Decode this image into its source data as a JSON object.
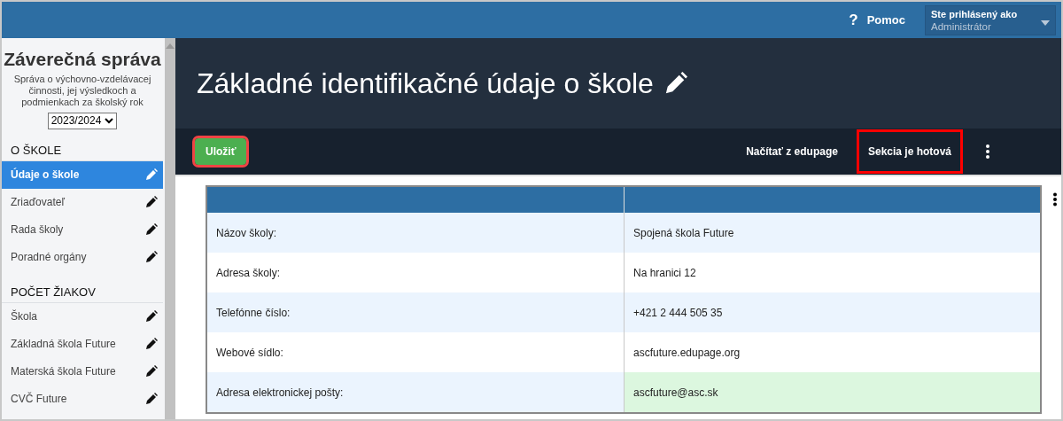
{
  "topbar": {
    "help_icon": "?",
    "help": "Pomoc",
    "user_caption": "Ste prihlásený ako",
    "user_name": "Administrátor"
  },
  "sidebar": {
    "title": "Záverečná správa",
    "subtitle": "Správa o výchovno-vzdelávacej činnosti, jej výsledkoch a podmienkach za školský rok",
    "year": "2023/2024",
    "sections": [
      {
        "heading": "O ŠKOLE",
        "items": [
          {
            "label": "Údaje o škole",
            "selected": true
          },
          {
            "label": "Zriaďovateľ",
            "selected": false
          },
          {
            "label": "Rada školy",
            "selected": false
          },
          {
            "label": "Poradné orgány",
            "selected": false
          }
        ]
      },
      {
        "heading": "POČET ŽIAKOV",
        "items": [
          {
            "label": "Škola",
            "selected": false
          },
          {
            "label": "Základná škola Future",
            "selected": false
          },
          {
            "label": "Materská škola Future",
            "selected": false
          },
          {
            "label": "CVČ Future",
            "selected": false
          }
        ]
      }
    ]
  },
  "page_title": "Základné identifikačné údaje o škole",
  "toolbar": {
    "buttons": [
      {
        "label": "Uložiť",
        "kind": "primary",
        "highlighted": true
      },
      {
        "label": "Načítať z edupage",
        "kind": "plain",
        "highlighted": false
      },
      {
        "label": "Sekcia je hotová",
        "kind": "plain",
        "highlighted": true
      }
    ]
  },
  "table": {
    "rows": [
      {
        "label": "Názov školy:",
        "value": "Spojená škola Future",
        "highlighted": false
      },
      {
        "label": "Adresa školy:",
        "value": "Na hranici 12",
        "highlighted": false
      },
      {
        "label": "Telefónne číslo:",
        "value": "+421 2 444 505 35",
        "highlighted": false
      },
      {
        "label": "Webové sídlo:",
        "value": "ascfuture.edupage.org",
        "highlighted": false
      },
      {
        "label": "Adresa elektronickej pošty:",
        "value": "ascfuture@asc.sk",
        "highlighted": true
      }
    ]
  }
}
